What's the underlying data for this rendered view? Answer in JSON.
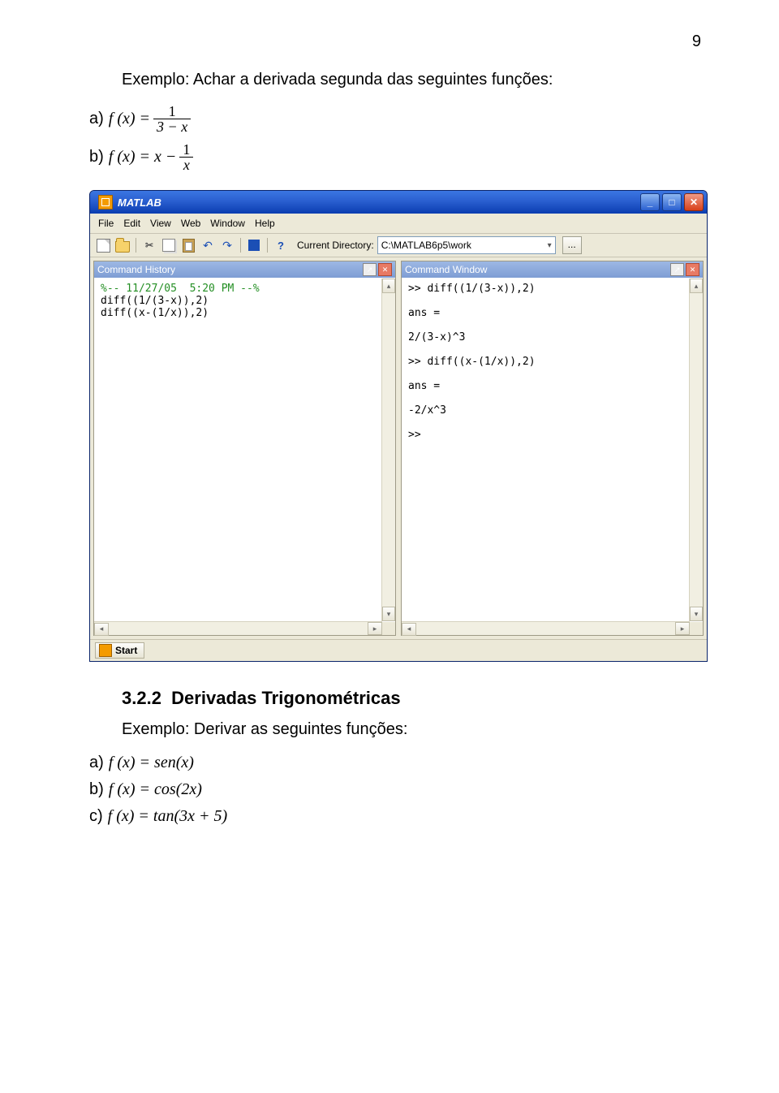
{
  "page_number": "9",
  "intro_text": "Exemplo: Achar a derivada segunda das seguintes funções:",
  "items_top": {
    "a": {
      "label": "a)",
      "prefix": "f (x) =",
      "num": "1",
      "den": "3 − x"
    },
    "b": {
      "label": "b)",
      "prefix": "f (x) = x −",
      "num": "1",
      "den": "x"
    }
  },
  "section": {
    "number": "3.2.2",
    "title": "Derivadas Trigonométricas",
    "example": "Exemplo: Derivar as seguintes funções:"
  },
  "items_bottom": {
    "a": {
      "label": "a)",
      "expr": "f (x) = sen(x)"
    },
    "b": {
      "label": "b)",
      "expr": "f (x) = cos(2x)"
    },
    "c": {
      "label": "c)",
      "expr": "f (x) = tan(3x + 5)"
    }
  },
  "matlab": {
    "title": "MATLAB",
    "menu": [
      "File",
      "Edit",
      "View",
      "Web",
      "Window",
      "Help"
    ],
    "dir_label": "Current Directory:",
    "dir_value": "C:\\MATLAB6p5\\work",
    "browse": "...",
    "panes": {
      "history": {
        "title": "Command History",
        "lines": [
          {
            "text": "%-- 11/27/05  5:20 PM --%",
            "comment": true
          },
          {
            "text": "diff((1/(3-x)),2)"
          },
          {
            "text": "diff((x-(1/x)),2)"
          }
        ]
      },
      "command": {
        "title": "Command Window",
        "lines": [
          {
            "text": ">> diff((1/(3-x)),2)"
          },
          {
            "text": " "
          },
          {
            "text": "ans ="
          },
          {
            "text": " "
          },
          {
            "text": "2/(3-x)^3"
          },
          {
            "text": " "
          },
          {
            "text": ">> diff((x-(1/x)),2)"
          },
          {
            "text": " "
          },
          {
            "text": "ans ="
          },
          {
            "text": " "
          },
          {
            "text": "-2/x^3"
          },
          {
            "text": " "
          },
          {
            "text": ">>"
          }
        ]
      }
    },
    "start": "Start"
  }
}
